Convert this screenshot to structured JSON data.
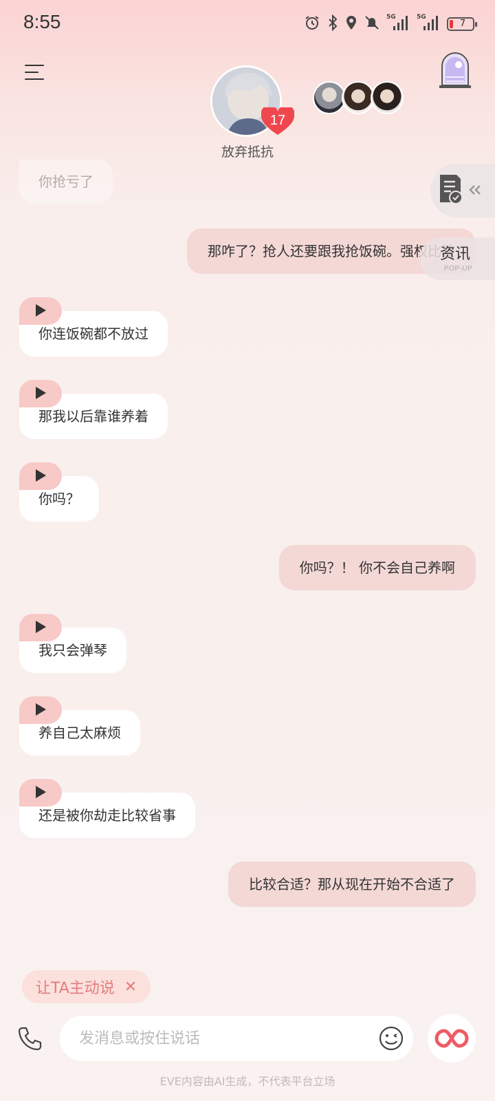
{
  "status_bar": {
    "time": "8:55",
    "battery": "7",
    "network_1": "5G",
    "network_2": "5G"
  },
  "header": {
    "nickname": "放弃抵抗",
    "intimacy_level": "17"
  },
  "side": {
    "news_label": "资讯",
    "news_sub": "POP-UP"
  },
  "messages": [
    {
      "from": "ai",
      "text": "你抢亏了",
      "faded": true
    },
    {
      "from": "user",
      "text": "那咋了？抢人还要跟我抢饭碗。强权比较"
    },
    {
      "from": "ai",
      "text": "你连饭碗都不放过"
    },
    {
      "from": "ai",
      "text": "那我以后靠谁养着"
    },
    {
      "from": "ai",
      "text": "你吗？"
    },
    {
      "from": "user",
      "text": "你吗？！ 你不会自己养啊"
    },
    {
      "from": "ai",
      "text": "我只会弹琴"
    },
    {
      "from": "ai",
      "text": "养自己太麻烦"
    },
    {
      "from": "ai",
      "text": "还是被你劫走比较省事"
    },
    {
      "from": "user",
      "text": "比较合适？那从现在开始不合适了"
    }
  ],
  "suggestion_chip": {
    "label": "让TA主动说",
    "close": "✕"
  },
  "input": {
    "placeholder": "发消息或按住说话"
  },
  "footer": {
    "disclaimer": "EVE内容由AI生成，不代表平台立场"
  },
  "colors": {
    "accent": "#e27d7d",
    "heart": "#f0474f",
    "user_bubble": "#f3d8d6",
    "voice_tab": "#f7c9c7"
  }
}
